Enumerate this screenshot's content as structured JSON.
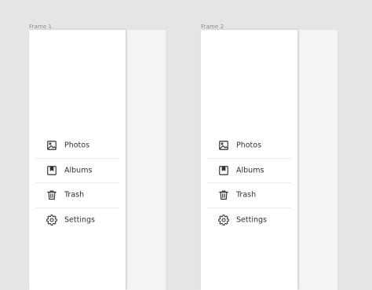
{
  "frames": [
    {
      "label": "Frame 1",
      "menu": [
        {
          "label": "Photos",
          "icon": "image-icon"
        },
        {
          "label": "Albums",
          "icon": "album-bookmark-icon"
        },
        {
          "label": "Trash",
          "icon": "trash-icon"
        },
        {
          "label": "Settings",
          "icon": "gear-icon"
        }
      ]
    },
    {
      "label": "Frame 2",
      "menu": [
        {
          "label": "Photos",
          "icon": "image-icon"
        },
        {
          "label": "Albums",
          "icon": "album-bookmark-icon"
        },
        {
          "label": "Trash",
          "icon": "trash-icon"
        },
        {
          "label": "Settings",
          "icon": "gear-icon"
        }
      ]
    }
  ],
  "colors": {
    "canvas": "#e5e5e5",
    "drawer": "#ffffff",
    "content": "#f5f5f5",
    "text": "#303030",
    "divider": "#ececec"
  }
}
